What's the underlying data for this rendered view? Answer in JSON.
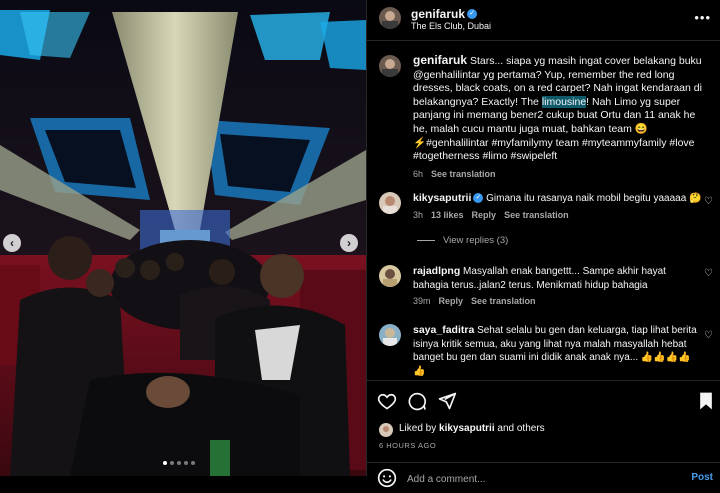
{
  "post": {
    "username": "genifaruk",
    "location": "The Els Club, Dubai",
    "caption_before": "Stars... siapa yg masih ingat cover belakang buku @genhalilintar yg pertama? Yup, remember the red long dresses, black coats, on a red carpet? Nah ingat kendaraan di belakangnya? Exactly! The ",
    "caption_highlight": "limousine",
    "caption_after": "! Nah Limo yg super panjang ini memang bener2 cukup buat Ortu dan 11 anak he he, malah cucu mantu juga muat, bahkan team 😄⚡#genhalilintar #myfamilymy team #myteammyfamily #love #togetherness #limo #swipeleft",
    "caption_time": "6h",
    "see_translation": "See translation",
    "liked_by_user": "kikysaputrii",
    "liked_by_suffix": "and others",
    "liked_by_prefix": "Liked by",
    "posted_ago": "6 HOURS AGO",
    "add_comment_placeholder": "Add a comment...",
    "post_label": "Post"
  },
  "comments": [
    {
      "username": "kikysaputrii",
      "verified": true,
      "text": "Gimana itu rasanya naik mobil begitu yaaaaa 🤔",
      "time": "3h",
      "likes": "13 likes",
      "reply": "Reply",
      "translation": "See translation",
      "view_replies": "View replies (3)"
    },
    {
      "username": "rajadlpng",
      "verified": false,
      "text": "Masyallah enak bangettt... Sampe akhir hayat bahagia terus..jalan2 terus. Menikmati hidup bahagia",
      "time": "39m",
      "reply": "Reply",
      "translation": "See translation"
    },
    {
      "username": "saya_faditra",
      "verified": false,
      "text": "Sehat selalu bu gen dan keluarga, tiap lihat berita isinya kritik semua, aku yang lihat nya malah masyallah hebat banget bu gen dan suami ini didik anak anak nya... 👍👍👍👍👍",
      "time": "",
      "reply": "",
      "translation": ""
    }
  ],
  "icons": {
    "like": "heart-icon",
    "comment": "comment-icon",
    "share": "paper-plane-icon",
    "save": "bookmark-icon",
    "emoji": "emoji-icon",
    "more": "more-icon",
    "prev": "chevron-left-icon",
    "next": "chevron-right-icon"
  },
  "colors": {
    "background": "#000000",
    "verified": "#3897f0",
    "link": "#4a9ef0",
    "highlight": "#0e5a6a",
    "muted": "#a8a8a8"
  },
  "carousel": {
    "total_slides": 5,
    "active_slide": 1
  }
}
